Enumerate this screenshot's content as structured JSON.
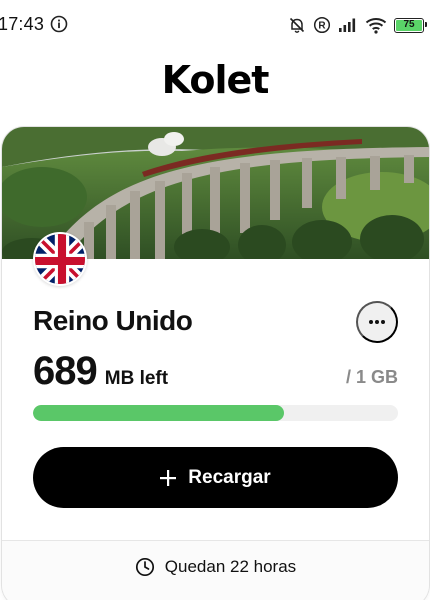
{
  "status_bar": {
    "time": "17:43",
    "battery_level": "75",
    "icons": [
      "info-icon",
      "bell-off-icon",
      "registered-icon",
      "signal-icon",
      "wifi-icon",
      "battery-icon"
    ],
    "battery_color": "#5ad468"
  },
  "app": {
    "logo": "Kolet"
  },
  "card": {
    "country": "Reino Unido",
    "flag_icon": "uk-flag-icon",
    "data_left_amount": "689",
    "data_left_unit": "MB left",
    "data_total": "/ 1 GB",
    "usage_fraction": 0.689,
    "progress_color": "#5ac768",
    "recharge_label": "Recargar",
    "footer_text": "Quedan 22 horas",
    "footer_icon": "clock-icon"
  }
}
